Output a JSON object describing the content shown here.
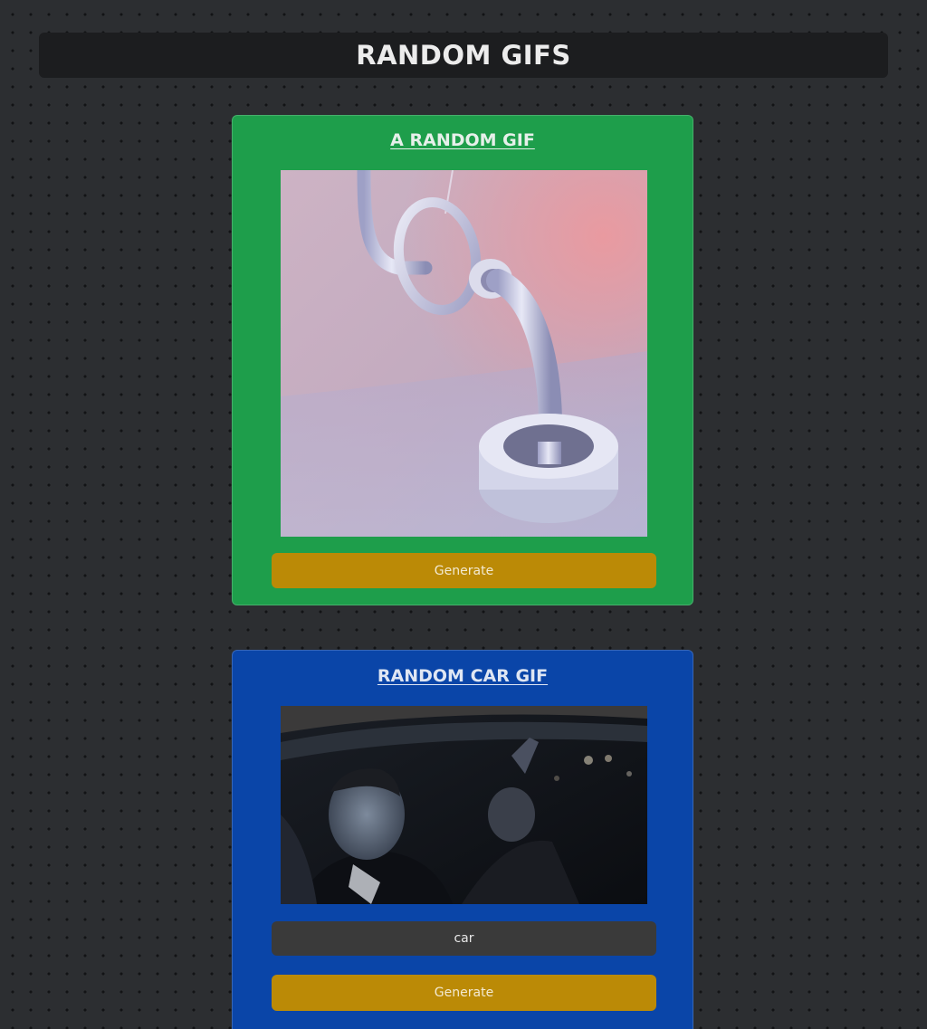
{
  "header": {
    "title": "RANDOM GIFS"
  },
  "random_card": {
    "title": "A RANDOM GIF",
    "button_label": "Generate",
    "background_color": "#1e9e4b",
    "button_color": "#bb8a06"
  },
  "car_card": {
    "title": "RANDOM CAR GIF",
    "tag_value": "car",
    "button_label": "Generate",
    "background_color": "#0a45a8",
    "button_color": "#bb8a06"
  }
}
